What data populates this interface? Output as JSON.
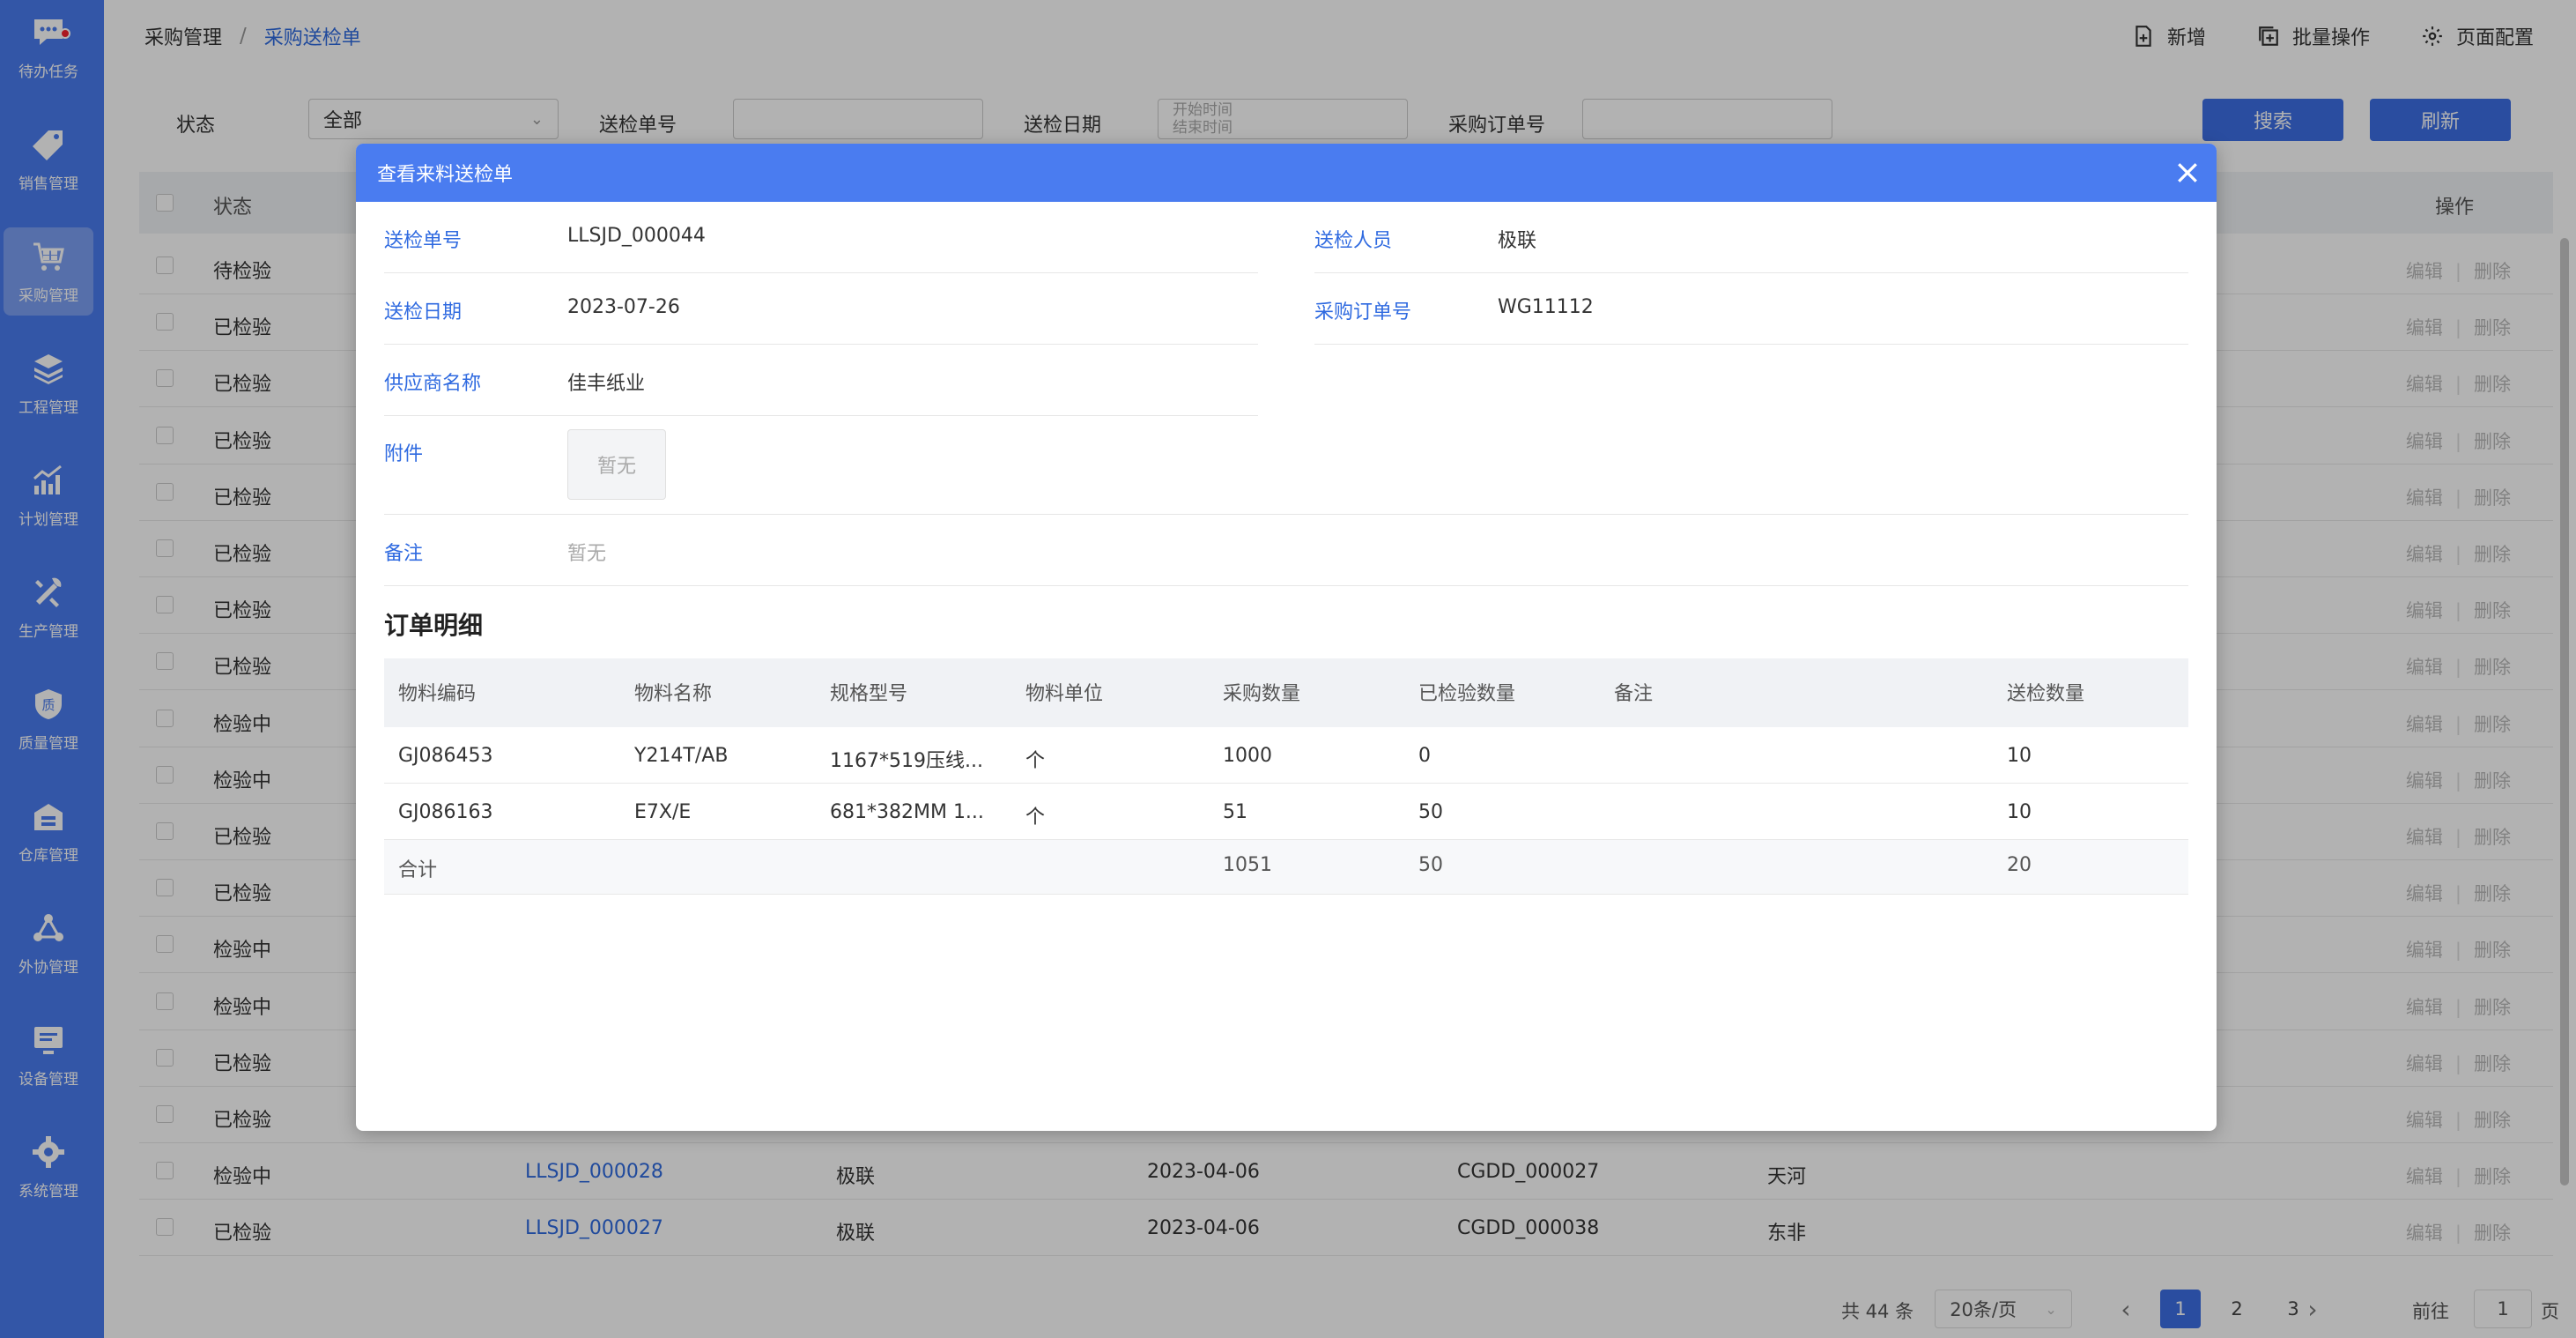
{
  "sidebar": {
    "items": [
      {
        "label": "待办任务",
        "icon": "chat-icon",
        "badge": true
      },
      {
        "label": "销售管理",
        "icon": "tag-icon"
      },
      {
        "label": "采购管理",
        "icon": "cart-icon",
        "active": true
      },
      {
        "label": "工程管理",
        "icon": "layers-icon"
      },
      {
        "label": "计划管理",
        "icon": "chart-icon"
      },
      {
        "label": "生产管理",
        "icon": "tools-icon"
      },
      {
        "label": "质量管理",
        "icon": "quality-shield-icon",
        "glyph": "质"
      },
      {
        "label": "仓库管理",
        "icon": "warehouse-icon"
      },
      {
        "label": "外协管理",
        "icon": "network-icon"
      },
      {
        "label": "设备管理",
        "icon": "monitor-icon"
      },
      {
        "label": "系统管理",
        "icon": "settings-gear-icon"
      }
    ]
  },
  "breadcrumb": {
    "parent": "采购管理",
    "separator": "/",
    "current": "采购送检单"
  },
  "top_actions": {
    "add": "新增",
    "batch": "批量操作",
    "page_config": "页面配置"
  },
  "filters": {
    "status_label": "状态",
    "status_value": "全部",
    "inspect_no_label": "送检单号",
    "inspect_date_label": "送检日期",
    "date_start_placeholder": "开始时间",
    "date_end_placeholder": "结束时间",
    "po_label": "采购订单号",
    "search_button": "搜索",
    "refresh_button": "刷新"
  },
  "table": {
    "headers": {
      "status": "状态",
      "action": "操作"
    },
    "edit_label": "编辑",
    "delete_label": "删除",
    "op_separator": "|",
    "rows": [
      {
        "status": "待检验"
      },
      {
        "status": "已检验"
      },
      {
        "status": "已检验"
      },
      {
        "status": "已检验"
      },
      {
        "status": "已检验"
      },
      {
        "status": "已检验"
      },
      {
        "status": "已检验"
      },
      {
        "status": "已检验"
      },
      {
        "status": "检验中"
      },
      {
        "status": "检验中"
      },
      {
        "status": "已检验"
      },
      {
        "status": "已检验"
      },
      {
        "status": "检验中"
      },
      {
        "status": "检验中"
      },
      {
        "status": "已检验"
      },
      {
        "status": "已检验"
      },
      {
        "status": "检验中",
        "no": "LLSJD_000028",
        "person": "极联",
        "date": "2023-04-06",
        "po": "CGDD_000027",
        "supplier": "天河"
      },
      {
        "status": "已检验",
        "no": "LLSJD_000027",
        "person": "极联",
        "date": "2023-04-06",
        "po": "CGDD_000038",
        "supplier": "东非"
      }
    ]
  },
  "pagination": {
    "total": "共 44 条",
    "page_size": "20条/页",
    "pages": [
      "1",
      "2",
      "3"
    ],
    "current_page": "1",
    "prev": "‹",
    "next": "›",
    "goto_label": "前往",
    "goto_value": "1",
    "goto_suffix": "页"
  },
  "modal": {
    "title": "查看来料送检单",
    "fields": {
      "inspect_no_label": "送检单号",
      "inspect_no": "LLSJD_000044",
      "inspector_label": "送检人员",
      "inspector": "极联",
      "inspect_date_label": "送检日期",
      "inspect_date": "2023-07-26",
      "po_label": "采购订单号",
      "po": "WG11112",
      "supplier_label": "供应商名称",
      "supplier": "佳丰纸业",
      "attachment_label": "附件",
      "attachment": "暂无",
      "remark_label": "备注",
      "remark": "暂无"
    },
    "detail_title": "订单明细",
    "detail_headers": [
      "物料编码",
      "物料名称",
      "规格型号",
      "物料单位",
      "采购数量",
      "已检验数量",
      "备注",
      "送检数量"
    ],
    "detail_rows": [
      [
        "GJ086453",
        "Y214T/AB",
        "1167*519压线...",
        "个",
        "1000",
        "0",
        "",
        "10"
      ],
      [
        "GJ086163",
        "E7X/E",
        "681*382MM 1...",
        "个",
        "51",
        "50",
        "",
        "10"
      ]
    ],
    "totals": {
      "label": "合计",
      "purchase": "1051",
      "inspected": "50",
      "send": "20"
    }
  }
}
